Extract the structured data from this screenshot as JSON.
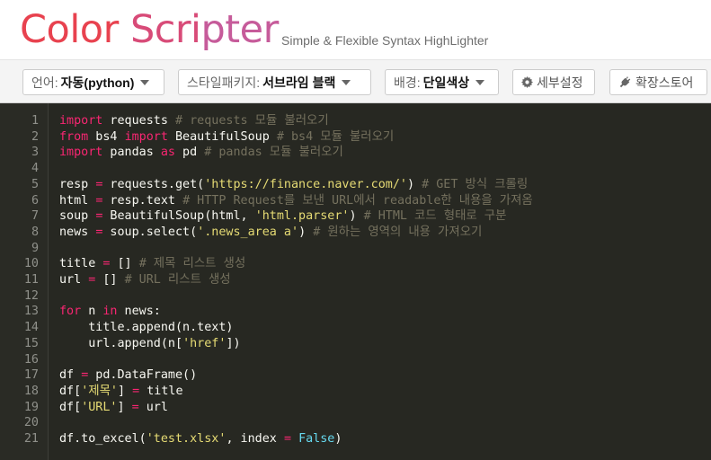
{
  "header": {
    "logo_part1": "Color ",
    "logo_part2": "Scri",
    "logo_part3": "pter",
    "tagline": "Simple & Flexible Syntax HighLighter"
  },
  "toolbar": {
    "language_label": "언어:",
    "language_value": "자동(python)",
    "style_label": "스타일패키지:",
    "style_value": "서브라임 블랙",
    "bg_label": "배경:",
    "bg_value": "단일색상",
    "settings_label": "세부설정",
    "store_label": "확장스토어"
  },
  "colors": {
    "editor_bg": "#272822",
    "keyword": "#f92672",
    "string": "#e6db74",
    "comment": "#75715e",
    "constant": "#66d9ef",
    "brand": "#e83d55"
  },
  "code": {
    "lines": [
      {
        "num": "1",
        "tokens": [
          {
            "t": "kw",
            "s": "import"
          },
          {
            "t": "p",
            "s": " requests "
          },
          {
            "t": "com",
            "s": "# requests 모듈 불러오기"
          }
        ]
      },
      {
        "num": "2",
        "tokens": [
          {
            "t": "kw",
            "s": "from"
          },
          {
            "t": "p",
            "s": " bs4 "
          },
          {
            "t": "kw",
            "s": "import"
          },
          {
            "t": "p",
            "s": " BeautifulSoup "
          },
          {
            "t": "com",
            "s": "# bs4 모듈 불러오기"
          }
        ]
      },
      {
        "num": "3",
        "tokens": [
          {
            "t": "kw",
            "s": "import"
          },
          {
            "t": "p",
            "s": " pandas "
          },
          {
            "t": "kw",
            "s": "as"
          },
          {
            "t": "p",
            "s": " pd "
          },
          {
            "t": "com",
            "s": "# pandas 모듈 불러오기"
          }
        ]
      },
      {
        "num": "4",
        "tokens": []
      },
      {
        "num": "5",
        "tokens": [
          {
            "t": "p",
            "s": "resp "
          },
          {
            "t": "kw",
            "s": "="
          },
          {
            "t": "p",
            "s": " requests.get("
          },
          {
            "t": "str",
            "s": "'https://finance.naver.com/'"
          },
          {
            "t": "p",
            "s": ") "
          },
          {
            "t": "com",
            "s": "# GET 방식 크롤링"
          }
        ]
      },
      {
        "num": "6",
        "tokens": [
          {
            "t": "p",
            "s": "html "
          },
          {
            "t": "kw",
            "s": "="
          },
          {
            "t": "p",
            "s": " resp.text "
          },
          {
            "t": "com",
            "s": "# HTTP Request를 보낸 URL에서 readable한 내용을 가져옴"
          }
        ]
      },
      {
        "num": "7",
        "tokens": [
          {
            "t": "p",
            "s": "soup "
          },
          {
            "t": "kw",
            "s": "="
          },
          {
            "t": "p",
            "s": " BeautifulSoup(html, "
          },
          {
            "t": "str",
            "s": "'html.parser'"
          },
          {
            "t": "p",
            "s": ") "
          },
          {
            "t": "com",
            "s": "# HTML 코드 형태로 구분"
          }
        ]
      },
      {
        "num": "8",
        "tokens": [
          {
            "t": "p",
            "s": "news "
          },
          {
            "t": "kw",
            "s": "="
          },
          {
            "t": "p",
            "s": " soup.select("
          },
          {
            "t": "str",
            "s": "'.news_area a'"
          },
          {
            "t": "p",
            "s": ") "
          },
          {
            "t": "com",
            "s": "# 원하는 영역의 내용 가져오기"
          }
        ]
      },
      {
        "num": "9",
        "tokens": []
      },
      {
        "num": "10",
        "tokens": [
          {
            "t": "p",
            "s": "title "
          },
          {
            "t": "kw",
            "s": "="
          },
          {
            "t": "p",
            "s": " [] "
          },
          {
            "t": "com",
            "s": "# 제목 리스트 생성"
          }
        ]
      },
      {
        "num": "11",
        "tokens": [
          {
            "t": "p",
            "s": "url "
          },
          {
            "t": "kw",
            "s": "="
          },
          {
            "t": "p",
            "s": " [] "
          },
          {
            "t": "com",
            "s": "# URL 리스트 생성"
          }
        ]
      },
      {
        "num": "12",
        "tokens": []
      },
      {
        "num": "13",
        "tokens": [
          {
            "t": "kw",
            "s": "for"
          },
          {
            "t": "p",
            "s": " n "
          },
          {
            "t": "kw",
            "s": "in"
          },
          {
            "t": "p",
            "s": " news:"
          }
        ]
      },
      {
        "num": "14",
        "tokens": [
          {
            "t": "p",
            "s": "    title.append(n.text)"
          }
        ]
      },
      {
        "num": "15",
        "tokens": [
          {
            "t": "p",
            "s": "    url.append(n["
          },
          {
            "t": "str",
            "s": "'href'"
          },
          {
            "t": "p",
            "s": "])"
          }
        ]
      },
      {
        "num": "16",
        "tokens": []
      },
      {
        "num": "17",
        "tokens": [
          {
            "t": "p",
            "s": "df "
          },
          {
            "t": "kw",
            "s": "="
          },
          {
            "t": "p",
            "s": " pd.DataFrame()"
          }
        ]
      },
      {
        "num": "18",
        "tokens": [
          {
            "t": "p",
            "s": "df["
          },
          {
            "t": "str",
            "s": "'제목'"
          },
          {
            "t": "p",
            "s": "] "
          },
          {
            "t": "kw",
            "s": "="
          },
          {
            "t": "p",
            "s": " title"
          }
        ]
      },
      {
        "num": "19",
        "tokens": [
          {
            "t": "p",
            "s": "df["
          },
          {
            "t": "str",
            "s": "'URL'"
          },
          {
            "t": "p",
            "s": "] "
          },
          {
            "t": "kw",
            "s": "="
          },
          {
            "t": "p",
            "s": " url"
          }
        ]
      },
      {
        "num": "20",
        "tokens": []
      },
      {
        "num": "21",
        "tokens": [
          {
            "t": "p",
            "s": "df.to_excel("
          },
          {
            "t": "str",
            "s": "'test.xlsx'"
          },
          {
            "t": "p",
            "s": ", index "
          },
          {
            "t": "kw",
            "s": "="
          },
          {
            "t": "p",
            "s": " "
          },
          {
            "t": "cons",
            "s": "False"
          },
          {
            "t": "p",
            "s": ")"
          }
        ]
      }
    ]
  }
}
